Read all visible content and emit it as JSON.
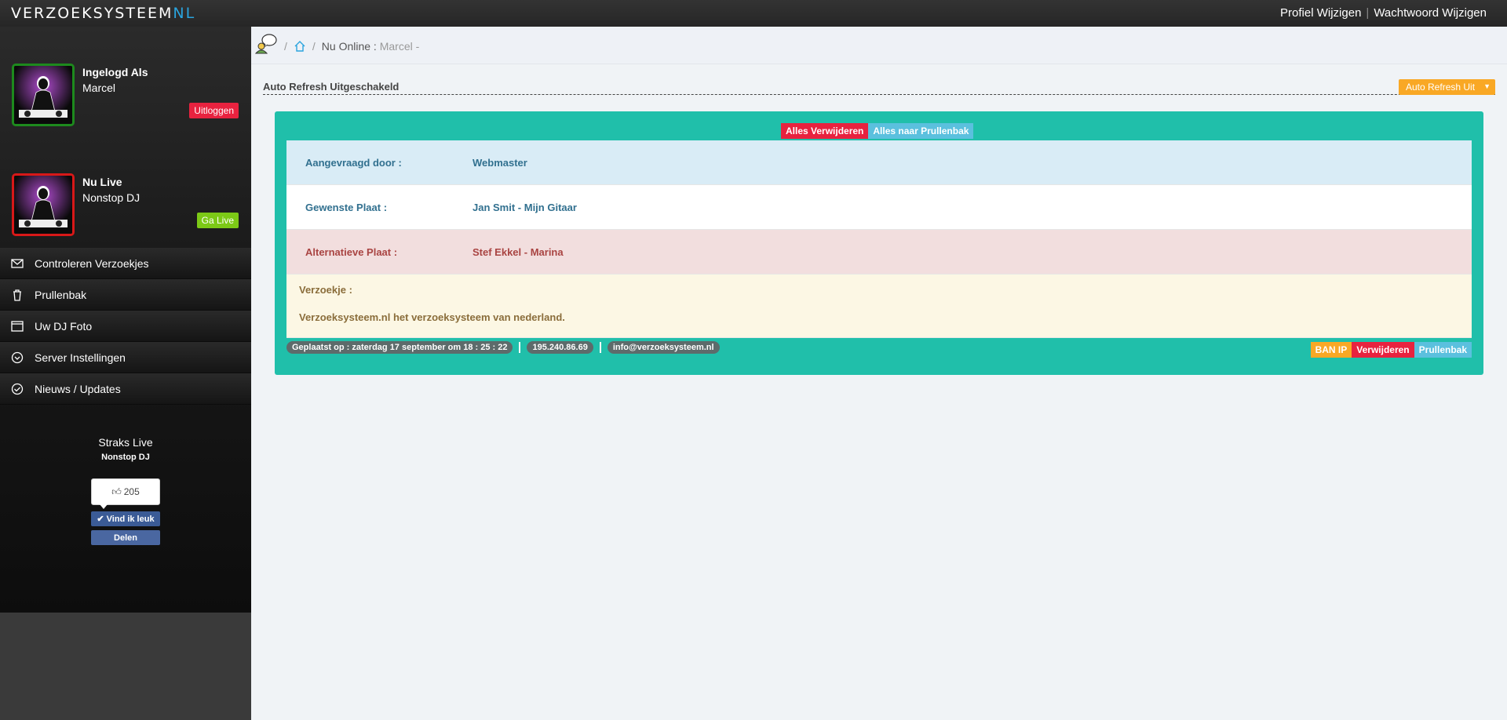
{
  "brand": {
    "text": "VERZOEKSYSTEEM",
    "accent": "NL"
  },
  "top_links": {
    "profile": "Profiel Wijzigen",
    "password": "Wachtwoord Wijzigen"
  },
  "sidebar": {
    "logged_in": {
      "title": "Ingelogd Als",
      "name": "Marcel",
      "button": "Uitloggen"
    },
    "now_live": {
      "title": "Nu Live",
      "name": "Nonstop DJ",
      "button": "Ga Live"
    },
    "menu": [
      {
        "label": "Controleren Verzoekjes",
        "icon": "envelope-icon"
      },
      {
        "label": "Prullenbak",
        "icon": "trash-icon"
      },
      {
        "label": "Uw DJ Foto",
        "icon": "window-icon"
      },
      {
        "label": "Server Instellingen",
        "icon": "chevron-circle-icon"
      },
      {
        "label": "Nieuws / Updates",
        "icon": "chat-circle-icon"
      }
    ],
    "straks_live": {
      "title": "Straks Live",
      "dj": "Nonstop DJ"
    },
    "facebook": {
      "count": "205",
      "like": "Vind ik leuk",
      "share": "Delen"
    }
  },
  "breadcrumb": {
    "online": "Nu Online :",
    "user": "Marcel -"
  },
  "auto_refresh": {
    "title": "Auto Refresh Uitgeschakeld",
    "button": "Auto Refresh Uit"
  },
  "request": {
    "delete_all": "Alles Verwijderen",
    "trash_all": "Alles naar Prullenbak",
    "requested_by_label": "Aangevraagd door :",
    "requested_by": "Webmaster",
    "wanted_label": "Gewenste Plaat :",
    "wanted": "Jan Smit - Mijn Gitaar",
    "alt_label": "Alternatieve Plaat :",
    "alt": "Stef Ekkel - Marina",
    "message_label": "Verzoekje :",
    "message": "Verzoeksysteem.nl het verzoeksysteem van nederland.",
    "placed": "Geplaatst op : zaterdag 17 september om 18 : 25 : 22",
    "ip": "195.240.86.69",
    "email": "info@verzoeksysteem.nl",
    "ban": "BAN IP",
    "delete": "Verwijderen",
    "trash": "Prullenbak"
  },
  "colors": {
    "teal": "#20bfaa",
    "red": "#e8223f",
    "blue": "#5bc0de",
    "orange": "#f9a825",
    "green": "#7cc916"
  }
}
